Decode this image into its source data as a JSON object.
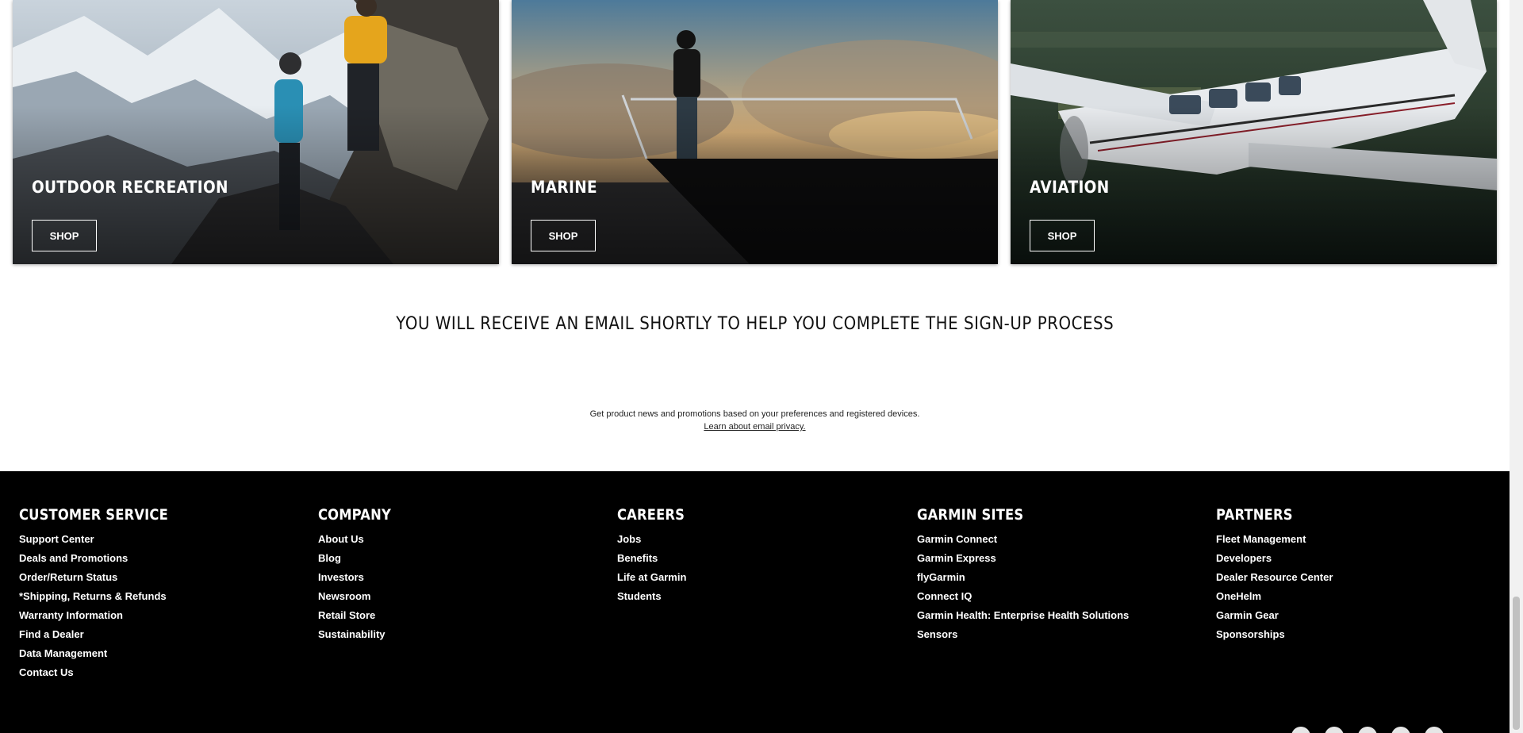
{
  "cards": [
    {
      "title": "OUTDOOR RECREATION",
      "button": "SHOP"
    },
    {
      "title": "MARINE",
      "button": "SHOP"
    },
    {
      "title": "AVIATION",
      "button": "SHOP"
    }
  ],
  "signup": {
    "message": "YOU WILL RECEIVE AN EMAIL SHORTLY TO HELP YOU COMPLETE THE SIGN-UP PROCESS",
    "promo_text": "Get product news and promotions based on your preferences and registered devices.",
    "privacy_link": "Learn about email privacy."
  },
  "footer": {
    "columns": [
      {
        "heading": "CUSTOMER SERVICE",
        "links": [
          "Support Center",
          "Deals and Promotions",
          "Order/Return Status",
          "*Shipping, Returns & Refunds",
          "Warranty Information",
          "Find a Dealer",
          "Data Management",
          "Contact Us"
        ]
      },
      {
        "heading": "COMPANY",
        "links": [
          "About Us",
          "Blog",
          "Investors",
          "Newsroom",
          "Retail Store",
          "Sustainability"
        ]
      },
      {
        "heading": "CAREERS",
        "links": [
          "Jobs",
          "Benefits",
          "Life at Garmin",
          "Students"
        ]
      },
      {
        "heading": "GARMIN SITES",
        "links": [
          "Garmin Connect",
          "Garmin Express",
          "flyGarmin",
          "Connect IQ",
          "Garmin Health: Enterprise Health Solutions",
          "Sensors"
        ]
      },
      {
        "heading": "PARTNERS",
        "links": [
          "Fleet Management",
          "Developers",
          "Dealer Resource Center",
          "OneHelm",
          "Garmin Gear",
          "Sponsorships"
        ]
      }
    ],
    "socials": [
      "facebook-icon",
      "twitter-icon",
      "youtube-icon",
      "pinterest-icon",
      "instagram-icon"
    ]
  },
  "colors": {
    "footer_bg": "#000000",
    "text": "#111111"
  }
}
